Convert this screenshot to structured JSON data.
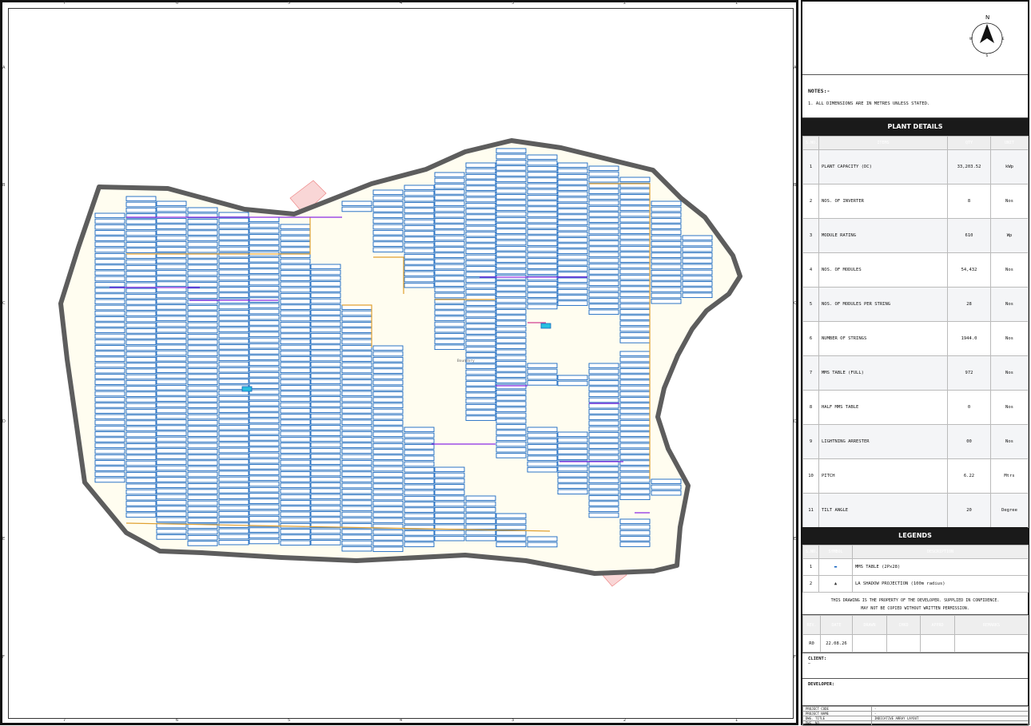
{
  "grid": {
    "columns": [
      "7",
      "6",
      "5",
      "4",
      "3",
      "2",
      "1"
    ],
    "rows": [
      "A",
      "B",
      "C",
      "D",
      "E",
      "F"
    ]
  },
  "plan": {
    "site_label": "Boundary"
  },
  "north": {
    "letter": "N",
    "e": "E",
    "w": "W",
    "s": "S"
  },
  "notes": {
    "heading": "NOTES:-",
    "items": [
      "1. ALL DIMENSIONS ARE IN METRES UNLESS STATED."
    ]
  },
  "plant_details": {
    "title": "PLANT DETAILS",
    "headers": [
      "S.NO.",
      "ITEMS",
      "QTY",
      "UNIT"
    ],
    "rows": [
      {
        "sno": "1",
        "item": "PLANT CAPACITY (DC)",
        "qty": "33,203.52",
        "unit": "kWp"
      },
      {
        "sno": "2",
        "item": "NOS. OF INVERTER",
        "qty": "8",
        "unit": "Nos"
      },
      {
        "sno": "3",
        "item": "MODULE RATING",
        "qty": "610",
        "unit": "Wp"
      },
      {
        "sno": "4",
        "item": "NOS. OF MODULES",
        "qty": "54,432",
        "unit": "Nos"
      },
      {
        "sno": "5",
        "item": "NOS. OF MODULES PER STRING",
        "qty": "28",
        "unit": "Nos"
      },
      {
        "sno": "6",
        "item": "NUMBER OF STRINGS",
        "qty": "1944.0",
        "unit": "Nos"
      },
      {
        "sno": "7",
        "item": "MMS TABLE (FULL)",
        "qty": "972",
        "unit": "Nos"
      },
      {
        "sno": "8",
        "item": "HALF MMS TABLE",
        "qty": "0",
        "unit": "Nos"
      },
      {
        "sno": "9",
        "item": "LIGHTNING ARRESTER",
        "qty": "00",
        "unit": "Nos"
      },
      {
        "sno": "10",
        "item": "PITCH",
        "qty": "6.22",
        "unit": "Mtrs"
      },
      {
        "sno": "11",
        "item": "TILT ANGLE",
        "qty": "20",
        "unit": "Degree"
      }
    ]
  },
  "legends": {
    "title": "LEGENDS",
    "headers": [
      "S.NO.",
      "SYMBOL",
      "DESCRIPTION"
    ],
    "rows": [
      {
        "sno": "1",
        "symbol": "▬",
        "desc": "MMS TABLE (2Px28)"
      },
      {
        "sno": "2",
        "symbol": "▲",
        "desc": "LA SHADOW PROJECTION (100m radius)"
      }
    ]
  },
  "confidentiality": {
    "line1": "THIS DRAWING IS THE PROPERTY OF THE DEVELOPER. SUPPLIED IN CONFIDENCE.",
    "line2": "MAY NOT BE COPIED WITHOUT WRITTEN PERMISSION."
  },
  "revisions": {
    "headers": [
      "REV.",
      "DATE",
      "DRAWN",
      "CHKD",
      "APPRD",
      "REMARKS"
    ],
    "rows": [
      {
        "rev": "R0",
        "date": "22.08.26",
        "drawn": "",
        "chkd": "",
        "apprd": "",
        "remarks": ""
      }
    ]
  },
  "client": {
    "label": "CLIENT:",
    "value": "—"
  },
  "developer": {
    "label": "DEVELOPER:"
  },
  "title_block": {
    "rows": [
      {
        "k": "PROJECT CODE",
        "v": "-"
      },
      {
        "k": "PROJECT NAME",
        "v": "-"
      },
      {
        "k": "DWG. TITLE",
        "v": "INDICATIVE ARRAY LAYOUT"
      },
      {
        "k": "DWG. NO.",
        "v": ""
      }
    ]
  },
  "colors": {
    "boundary": "#5d5d5d",
    "site_fill": "#fffdf0",
    "table_stroke": "#1565c0",
    "string_cable": "#8a2be2",
    "dc_cable": "#e0a030",
    "exclusion": "#f2a0a0",
    "inverter": "#29c0e0"
  }
}
